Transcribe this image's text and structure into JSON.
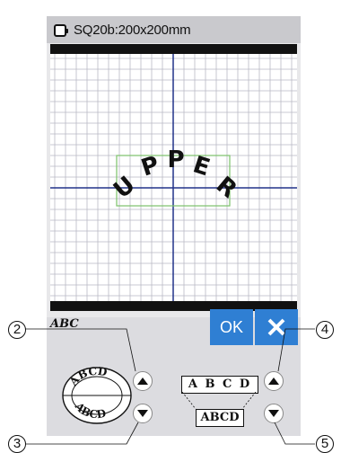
{
  "header": {
    "hoop_label": "SQ20b:200x200mm"
  },
  "canvas": {
    "design_text": "UPPER",
    "design_letters": [
      "U",
      "P",
      "P",
      "E",
      "R"
    ]
  },
  "controls": {
    "abc_icon": "ABC",
    "ok_label": "OK",
    "cancel_icon": "close-icon",
    "circle_top_text": "ABCD",
    "circle_bottom_text": "ABCD",
    "spaced_text": "A B C D",
    "compact_text": "ABCD"
  },
  "callouts": {
    "c2": "2",
    "c3": "3",
    "c4": "4",
    "c5": "5"
  },
  "colors": {
    "accent": "#2f7fd3",
    "grid_line": "#b9b9c4",
    "axis_line": "#22338a",
    "frame": "#111111"
  }
}
